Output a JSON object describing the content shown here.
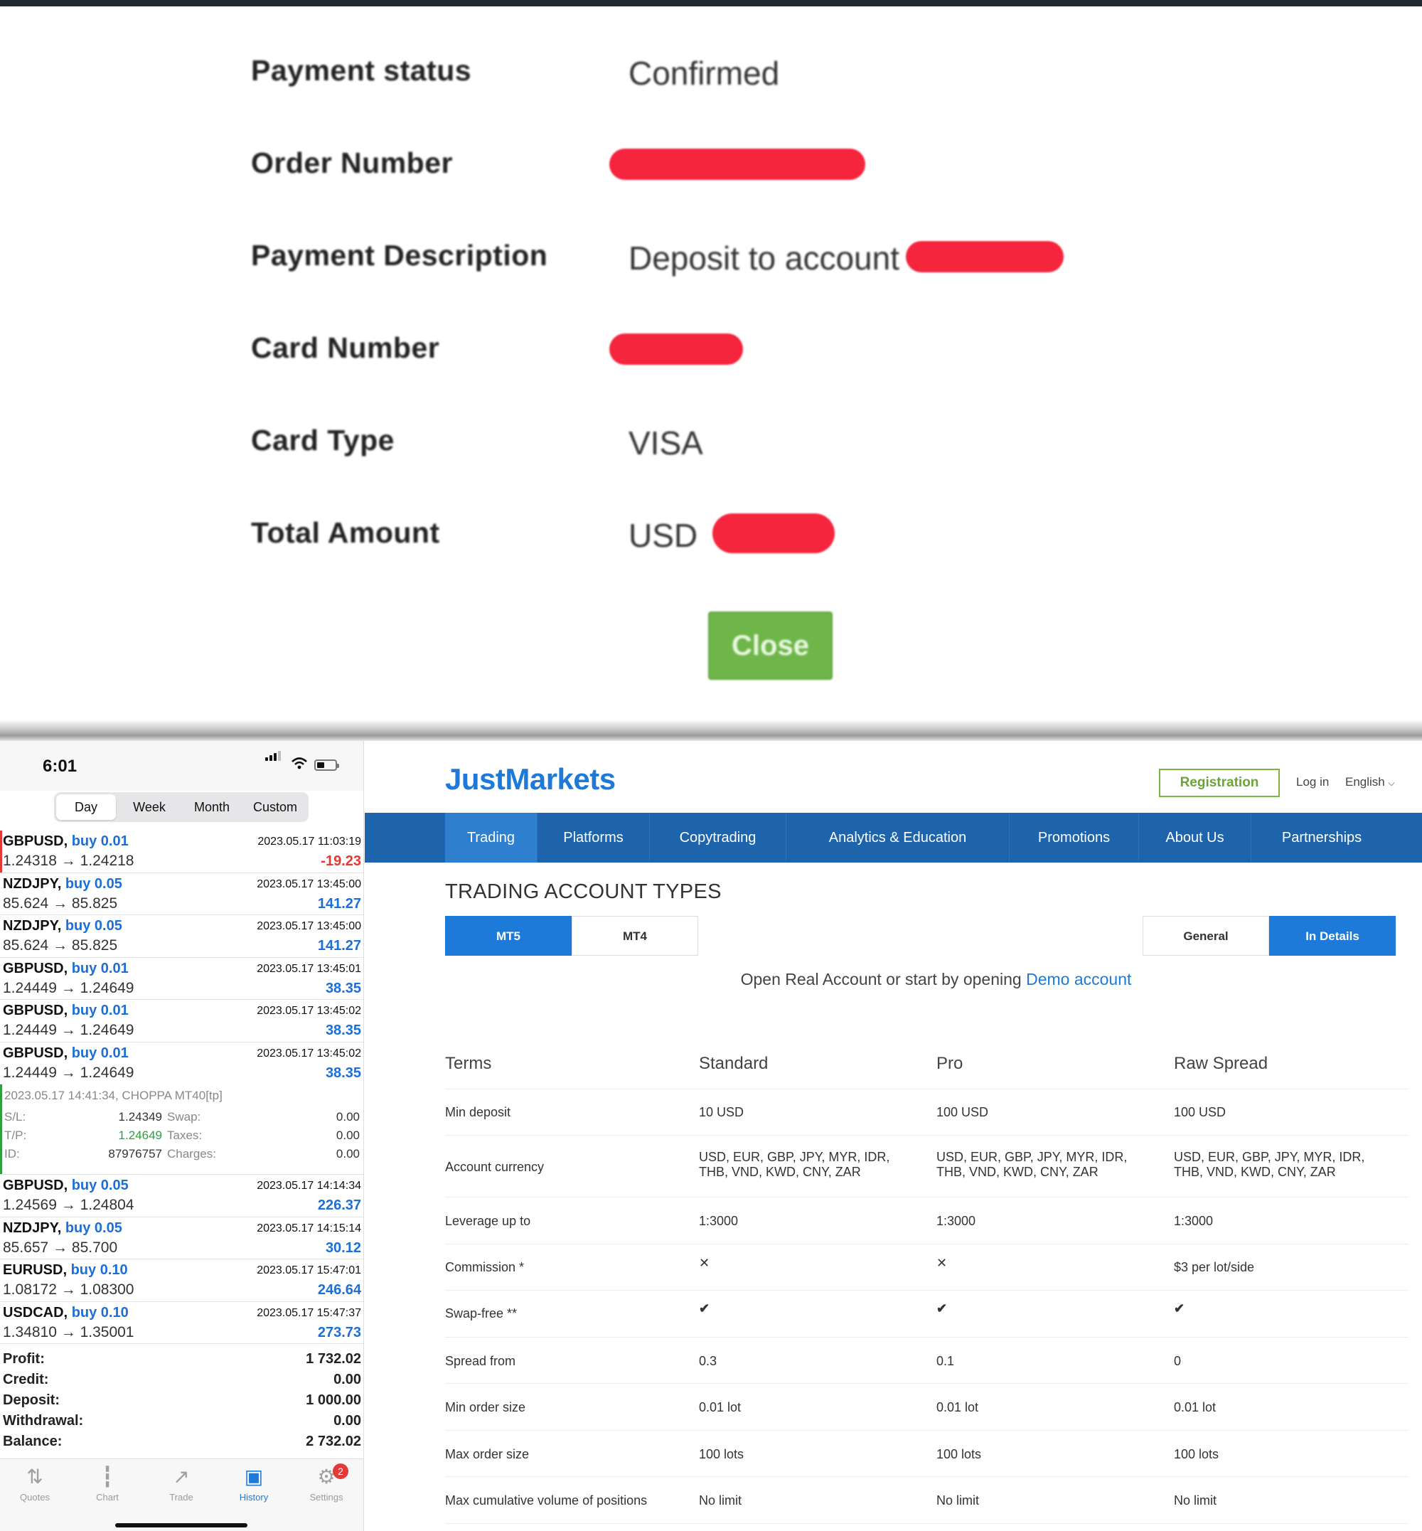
{
  "receipt": {
    "rows": [
      {
        "label": "Payment status",
        "value": "Confirmed"
      },
      {
        "label": "Order Number",
        "value": ""
      },
      {
        "label": "Payment Description",
        "value": "Deposit to account"
      },
      {
        "label": "Card Number",
        "value": ""
      },
      {
        "label": "Card Type",
        "value": "VISA"
      },
      {
        "label": "Total Amount",
        "value": "USD"
      }
    ],
    "close_label": "Close",
    "redact_color": "#f4253d"
  },
  "phone": {
    "time": "6:01",
    "tabs": [
      "Day",
      "Week",
      "Month",
      "Custom"
    ],
    "deals": [
      {
        "symbol": "GBPUSD,",
        "dir": "buy 0.01",
        "date": "2023.05.17 11:03:19",
        "prices": "1.24318 → 1.24218",
        "profit": "-19.23"
      },
      {
        "symbol": "NZDJPY,",
        "dir": "buy 0.05",
        "date": "2023.05.17 13:45:00",
        "prices": "85.624 → 85.825",
        "profit": "141.27"
      },
      {
        "symbol": "NZDJPY,",
        "dir": "buy 0.05",
        "date": "2023.05.17 13:45:00",
        "prices": "85.624 → 85.825",
        "profit": "141.27"
      },
      {
        "symbol": "GBPUSD,",
        "dir": "buy 0.01",
        "date": "2023.05.17 13:45:01",
        "prices": "1.24449 → 1.24649",
        "profit": "38.35"
      },
      {
        "symbol": "GBPUSD,",
        "dir": "buy 0.01",
        "date": "2023.05.17 13:45:02",
        "prices": "1.24449 → 1.24649",
        "profit": "38.35"
      },
      {
        "symbol": "GBPUSD,",
        "dir": "buy 0.01",
        "date": "2023.05.17 13:45:02",
        "prices": "1.24449 → 1.24649",
        "profit": "38.35"
      }
    ],
    "detail": {
      "header": "2023.05.17 14:41:34, CHOPPA MT40[tp]",
      "sl_label": "S/L:",
      "sl": "1.24349",
      "tp_label": "T/P:",
      "tp": "1.24649",
      "id_label": "ID:",
      "id": "87976757",
      "swap_label": "Swap:",
      "swap": "0.00",
      "taxes_label": "Taxes:",
      "taxes": "0.00",
      "charges_label": "Charges:",
      "charges": "0.00"
    },
    "deals2": [
      {
        "symbol": "GBPUSD,",
        "dir": "buy 0.05",
        "date": "2023.05.17 14:14:34",
        "prices": "1.24569 → 1.24804",
        "profit": "226.37"
      },
      {
        "symbol": "NZDJPY,",
        "dir": "buy 0.05",
        "date": "2023.05.17 14:15:14",
        "prices": "85.657 → 85.700",
        "profit": "30.12"
      },
      {
        "symbol": "EURUSD,",
        "dir": "buy 0.10",
        "date": "2023.05.17 15:47:01",
        "prices": "1.08172 → 1.08300",
        "profit": "246.64"
      },
      {
        "symbol": "USDCAD,",
        "dir": "buy 0.10",
        "date": "2023.05.17 15:47:37",
        "prices": "1.34810 → 1.35001",
        "profit": "273.73"
      }
    ],
    "summary": [
      {
        "label": "Profit:",
        "value": "1 732.02"
      },
      {
        "label": "Credit:",
        "value": "0.00"
      },
      {
        "label": "Deposit:",
        "value": "1 000.00"
      },
      {
        "label": "Withdrawal:",
        "value": "0.00"
      },
      {
        "label": "Balance:",
        "value": "2 732.02"
      }
    ],
    "tabbar": [
      {
        "label": "Quotes",
        "icon": "quotes-icon"
      },
      {
        "label": "Chart",
        "icon": "chart-icon"
      },
      {
        "label": "Trade",
        "icon": "trade-icon"
      },
      {
        "label": "History",
        "icon": "history-icon"
      },
      {
        "label": "Settings",
        "icon": "settings-icon"
      }
    ],
    "settings_badge": "2",
    "accent": "#1d6fd6",
    "loss_color": "#e53935"
  },
  "site": {
    "logo": "JustMarkets",
    "registration": "Registration",
    "login": "Log in",
    "language": "English",
    "nav": [
      "Trading",
      "Platforms",
      "Copytrading",
      "Analytics & Education",
      "Promotions",
      "About Us",
      "Partnerships"
    ],
    "title": "TRADING ACCOUNT TYPES",
    "platform_tabs": [
      "MT5",
      "MT4"
    ],
    "view_tabs": [
      "General",
      "In Details"
    ],
    "cta_text": "Open Real Account or start by opening ",
    "cta_link": "Demo account",
    "table": {
      "headers": [
        "Terms",
        "Standard",
        "Pro",
        "Raw Spread"
      ],
      "rows": [
        {
          "term": "Min deposit",
          "standard": "10 USD",
          "pro": "100 USD",
          "raw": "100 USD"
        },
        {
          "term": "Account currency",
          "standard": "USD, EUR, GBP, JPY, MYR, IDR, THB, VND, KWD, CNY, ZAR",
          "pro": "USD, EUR, GBP, JPY, MYR, IDR, THB, VND, KWD, CNY, ZAR",
          "raw": "USD, EUR, GBP, JPY, MYR, IDR, THB, VND, KWD, CNY, ZAR"
        },
        {
          "term": "Leverage up to",
          "standard": "1:3000",
          "pro": "1:3000",
          "raw": "1:3000"
        },
        {
          "term": "Commission *",
          "standard": "✕",
          "pro": "✕",
          "raw": "$3 per lot/side"
        },
        {
          "term": "Swap-free **",
          "standard": "✔",
          "pro": "✔",
          "raw": "✔"
        },
        {
          "term": "Spread from",
          "standard": "0.3",
          "pro": "0.1",
          "raw": "0"
        },
        {
          "term": "Min order size",
          "standard": "0.01 lot",
          "pro": "0.01 lot",
          "raw": "0.01 lot"
        },
        {
          "term": "Max order size",
          "standard": "100 lots",
          "pro": "100 lots",
          "raw": "100 lots"
        },
        {
          "term": "Max cumulative volume of positions",
          "standard": "No limit",
          "pro": "No limit",
          "raw": "No limit"
        }
      ]
    },
    "brand_color": "#1d7ad9",
    "nav_color": "#1d64ad",
    "registration_color": "#6aa437"
  }
}
